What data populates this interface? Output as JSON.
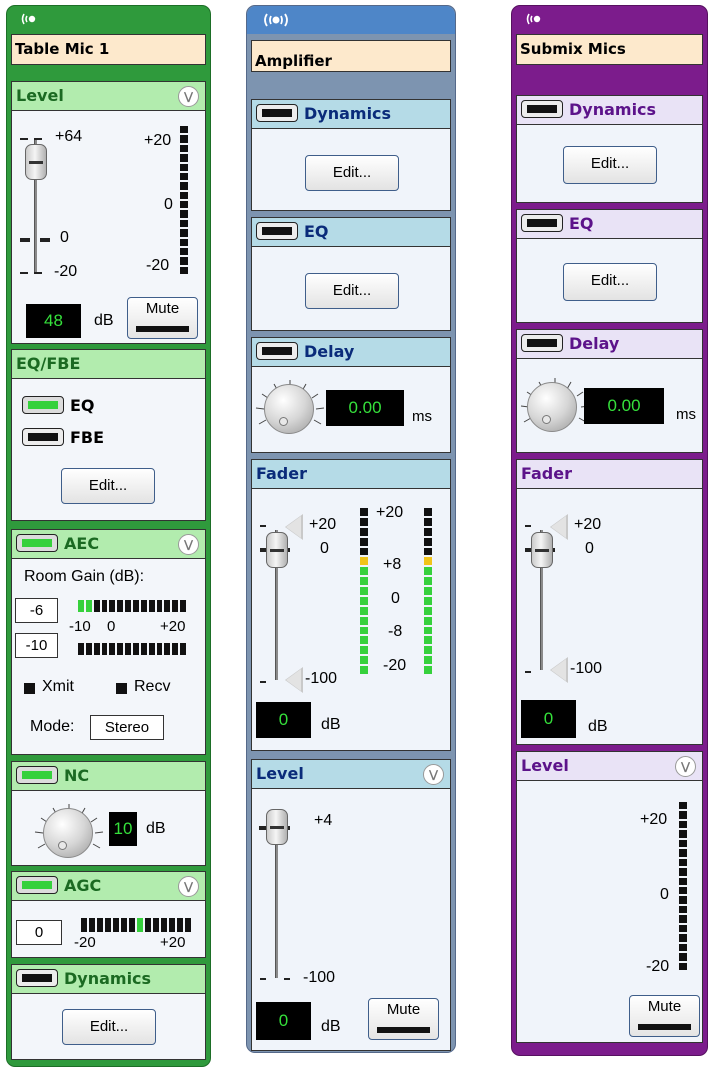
{
  "colors": {
    "green": "#2f9a3c",
    "blue": "#7d94b0",
    "purple": "#7c1c8c",
    "meter_on": "#36d13c",
    "meter_mid": "#f0c419"
  },
  "strip1": {
    "icon": "broadcast-icon",
    "name": "Table Mic 1",
    "level": {
      "title": "Level",
      "scale_top": "+64",
      "scale_mid": "0",
      "scale_bot": "-20",
      "meter_top": "+20",
      "meter_mid": "0",
      "meter_bot": "-20",
      "value": "48",
      "unit": "dB",
      "mute": "Mute"
    },
    "eqfbe": {
      "title": "EQ/FBE",
      "eq": "EQ",
      "fbe": "FBE",
      "edit": "Edit..."
    },
    "aec": {
      "title": "AEC",
      "room_gain": "Room Gain (dB):",
      "gain1": "-6",
      "gain2": "-10",
      "s1": "-10",
      "s2": "0",
      "s3": "+20",
      "xmit": "Xmit",
      "recv": "Recv",
      "mode_label": "Mode:",
      "mode": "Stereo"
    },
    "nc": {
      "title": "NC",
      "value": "10",
      "unit": "dB"
    },
    "agc": {
      "title": "AGC",
      "value": "0",
      "min": "-20",
      "max": "+20"
    },
    "dynamics": {
      "title": "Dynamics",
      "edit": "Edit..."
    }
  },
  "strip2": {
    "icon": "broadcast-icon",
    "name": "Amplifier",
    "dynamics": {
      "title": "Dynamics",
      "edit": "Edit..."
    },
    "eq": {
      "title": "EQ",
      "edit": "Edit..."
    },
    "delay": {
      "title": "Delay",
      "value": "0.00",
      "unit": "ms"
    },
    "fader": {
      "title": "Fader",
      "top": "+20",
      "zero": "0",
      "bot": "-100",
      "value": "0",
      "unit": "dB",
      "m_top": "+20",
      "m_8": "+8",
      "m_0": "0",
      "m_n8": "-8",
      "m_n20": "-20"
    },
    "level": {
      "title": "Level",
      "top": "+4",
      "bot": "-100",
      "value": "0",
      "unit": "dB",
      "mute": "Mute"
    }
  },
  "strip3": {
    "icon": "broadcast-icon",
    "name": "Submix Mics",
    "dynamics": {
      "title": "Dynamics",
      "edit": "Edit..."
    },
    "eq": {
      "title": "EQ",
      "edit": "Edit..."
    },
    "delay": {
      "title": "Delay",
      "value": "0.00",
      "unit": "ms"
    },
    "fader": {
      "title": "Fader",
      "top": "+20",
      "zero": "0",
      "bot": "-100",
      "value": "0",
      "unit": "dB"
    },
    "level": {
      "title": "Level",
      "top": "+20",
      "mid": "0",
      "bot": "-20",
      "mute": "Mute"
    }
  }
}
